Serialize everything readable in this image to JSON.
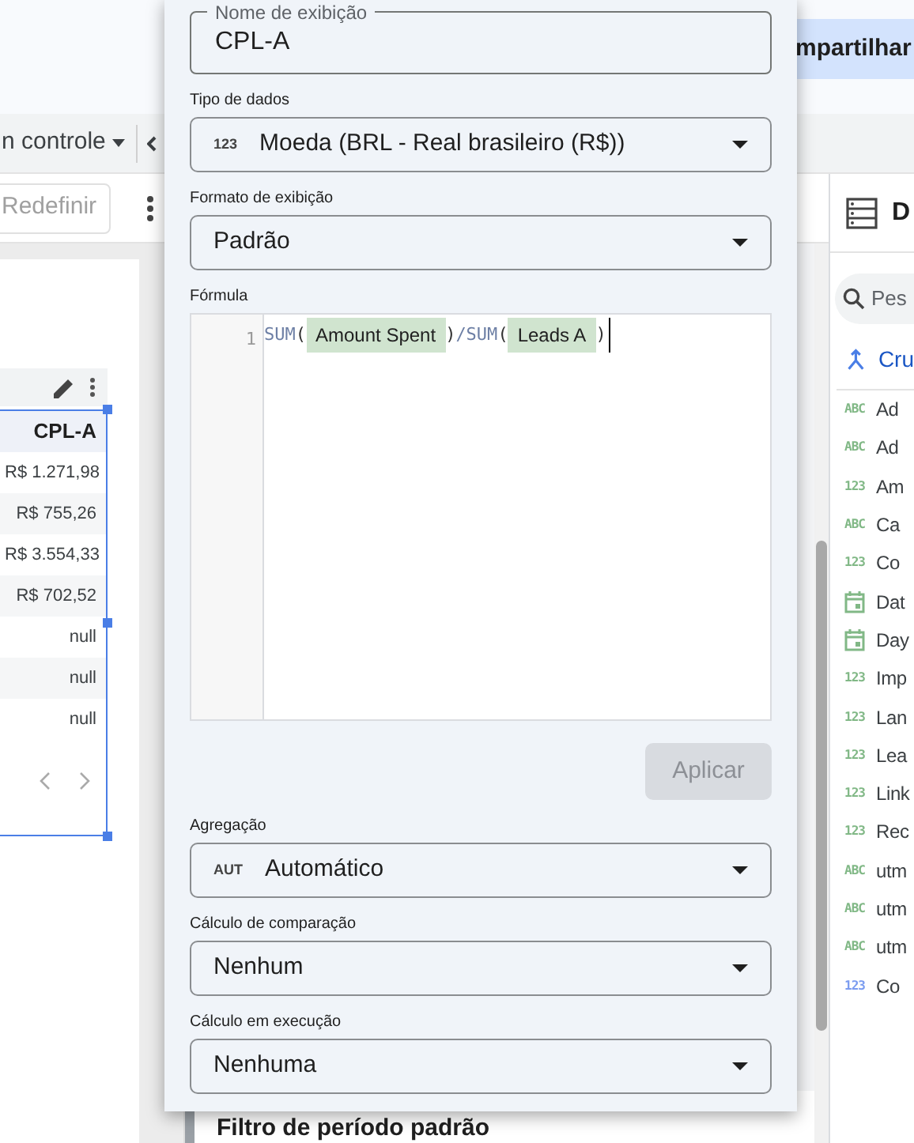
{
  "header": {
    "share_button": "mpartilhar"
  },
  "toolbar": {
    "menu": "n controle"
  },
  "reset_button": "Redefinir",
  "table": {
    "column": "CPL-A",
    "rows": [
      "R$ 1.271,98",
      "R$ 755,26",
      "R$ 3.554,33",
      "R$ 702,52",
      "null",
      "null",
      "null"
    ]
  },
  "editor": {
    "display_name": {
      "label": "Nome de exibição",
      "value": "CPL-A"
    },
    "settings_top": [
      {
        "label": "Tipo de dados",
        "tag": "123",
        "value": "Moeda (BRL - Real brasileiro (R$))"
      },
      {
        "label": "Formato de exibição",
        "value": "Padrão"
      }
    ],
    "formula": {
      "label": "Fórmula",
      "line_number": "1",
      "tokens": [
        {
          "kind": "function",
          "text": "SUM"
        },
        {
          "kind": "punct",
          "text": "("
        },
        {
          "kind": "field",
          "text": "Amount Spent"
        },
        {
          "kind": "punct",
          "text": ")"
        },
        {
          "kind": "function",
          "text": "/SUM"
        },
        {
          "kind": "punct",
          "text": "("
        },
        {
          "kind": "field",
          "text": "Leads A"
        },
        {
          "kind": "punct",
          "text": ")"
        }
      ]
    },
    "apply_button": {
      "label": "Aplicar",
      "disabled": true
    },
    "settings_bottom": [
      {
        "label": "Agregação",
        "tag": "AUT",
        "value": "Automático"
      },
      {
        "label": "Cálculo de comparação",
        "value": "Nenhum"
      },
      {
        "label": "Cálculo em execução",
        "value": "Nenhuma"
      }
    ]
  },
  "section_title": "Filtro de período padrão",
  "data_panel": {
    "title": "D",
    "search": {
      "placeholder": "Pes"
    },
    "blend_item": "Cru",
    "fields": [
      {
        "kind": "text",
        "tag": "ABC",
        "label": "Ad",
        "color": "#81b886"
      },
      {
        "kind": "text",
        "tag": "ABC",
        "label": "Ad",
        "color": "#81b886"
      },
      {
        "kind": "number",
        "tag": "123",
        "label": "Am",
        "color": "#81b886"
      },
      {
        "kind": "text",
        "tag": "ABC",
        "label": "Ca",
        "color": "#81b886"
      },
      {
        "kind": "number",
        "tag": "123",
        "label": "Co",
        "color": "#81b886"
      },
      {
        "kind": "date",
        "label": "Dat",
        "color": "#81b886"
      },
      {
        "kind": "date",
        "label": "Day",
        "color": "#81b886"
      },
      {
        "kind": "number",
        "tag": "123",
        "label": "Imp",
        "color": "#81b886"
      },
      {
        "kind": "number",
        "tag": "123",
        "label": "Lan",
        "color": "#81b886"
      },
      {
        "kind": "number",
        "tag": "123",
        "label": "Lea",
        "color": "#81b886"
      },
      {
        "kind": "number",
        "tag": "123",
        "label": "Link",
        "color": "#81b886"
      },
      {
        "kind": "number",
        "tag": "123",
        "label": "Rec",
        "color": "#81b886"
      },
      {
        "kind": "text",
        "tag": "ABC",
        "label": "utm",
        "color": "#81b886"
      },
      {
        "kind": "text",
        "tag": "ABC",
        "label": "utm",
        "color": "#81b886"
      },
      {
        "kind": "text",
        "tag": "ABC",
        "label": "utm",
        "color": "#81b886"
      },
      {
        "kind": "number",
        "tag": "123",
        "label": "Co",
        "color": "#7b9cf0"
      }
    ]
  }
}
